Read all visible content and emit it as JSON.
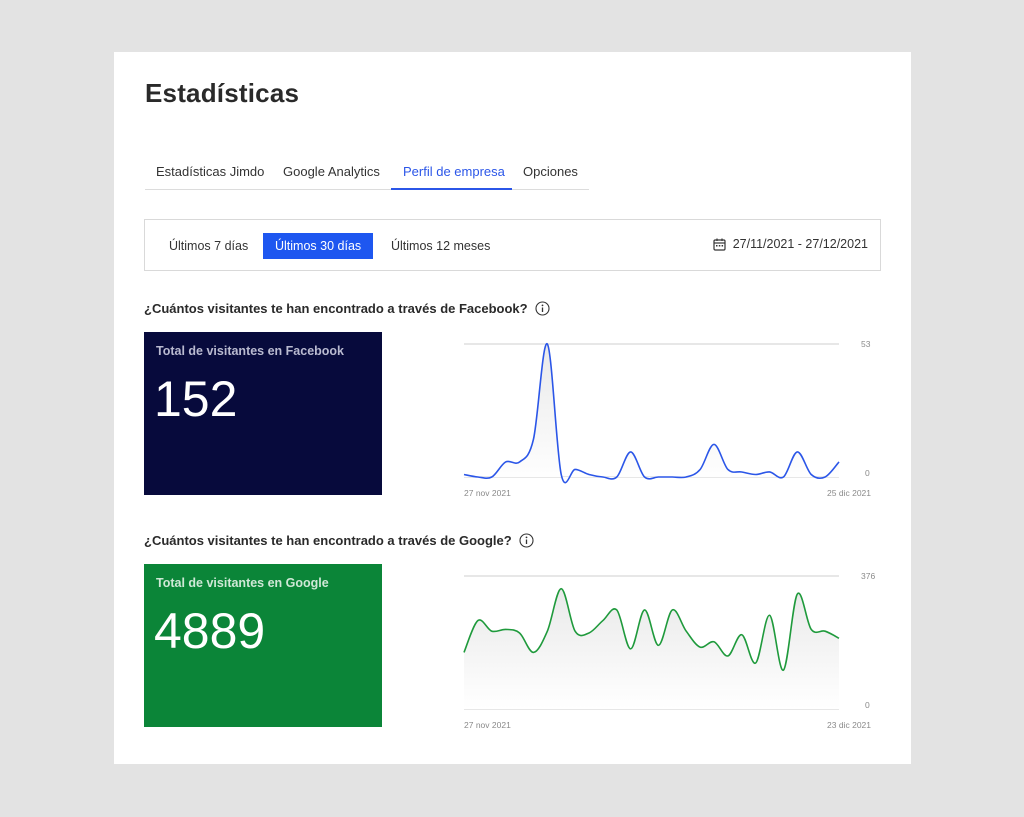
{
  "page": {
    "title": "Estadísticas"
  },
  "tabs": [
    {
      "label": "Estadísticas Jimdo",
      "active": false
    },
    {
      "label": "Google Analytics",
      "active": false
    },
    {
      "label": "Perfil de empresa",
      "active": true
    },
    {
      "label": "Opciones",
      "active": false
    }
  ],
  "range": {
    "buttons": [
      {
        "label": "Últimos 7 días",
        "active": false
      },
      {
        "label": "Últimos 30 días",
        "active": true
      },
      {
        "label": "Últimos 12 meses",
        "active": false
      }
    ],
    "date_range": "27/11/2021 - 27/12/2021",
    "icon": "calendar-icon"
  },
  "facebook": {
    "question": "¿Cuántos visitantes te han encontrado a través de Facebook?",
    "box_label": "Total de visitantes en Facebook",
    "total": "152",
    "box_color": "#070a3c",
    "line_color": "#2b56e8"
  },
  "google": {
    "question": "¿Cuántos visitantes te han encontrado a través de Google?",
    "box_label": "Total de visitantes en Google",
    "total": "4889",
    "box_color": "#0b8538",
    "line_color": "#1f9a3c"
  },
  "chart_data": [
    {
      "type": "area",
      "series": [
        {
          "values": [
            1,
            0,
            0,
            6,
            6,
            15,
            53,
            1,
            3,
            1,
            0,
            0,
            10,
            0,
            0,
            0,
            0,
            3,
            13,
            3,
            2,
            1,
            2,
            0,
            10,
            1,
            0,
            6
          ]
        }
      ],
      "x_start_label": "27 nov 2021",
      "x_end_label": "25 dic 2021",
      "y_max_label": "53",
      "y_min_label": "0",
      "ylim": [
        0,
        53
      ],
      "grid": true
    },
    {
      "type": "area",
      "series": [
        {
          "values": [
            160,
            250,
            220,
            225,
            215,
            160,
            220,
            340,
            220,
            215,
            250,
            280,
            170,
            280,
            180,
            280,
            220,
            175,
            190,
            150,
            210,
            130,
            265,
            110,
            325,
            225,
            220,
            200
          ]
        }
      ],
      "x_start_label": "27 nov 2021",
      "x_end_label": "23 dic 2021",
      "y_max_label": "376",
      "y_min_label": "0",
      "ylim": [
        0,
        376
      ],
      "grid": true
    }
  ]
}
